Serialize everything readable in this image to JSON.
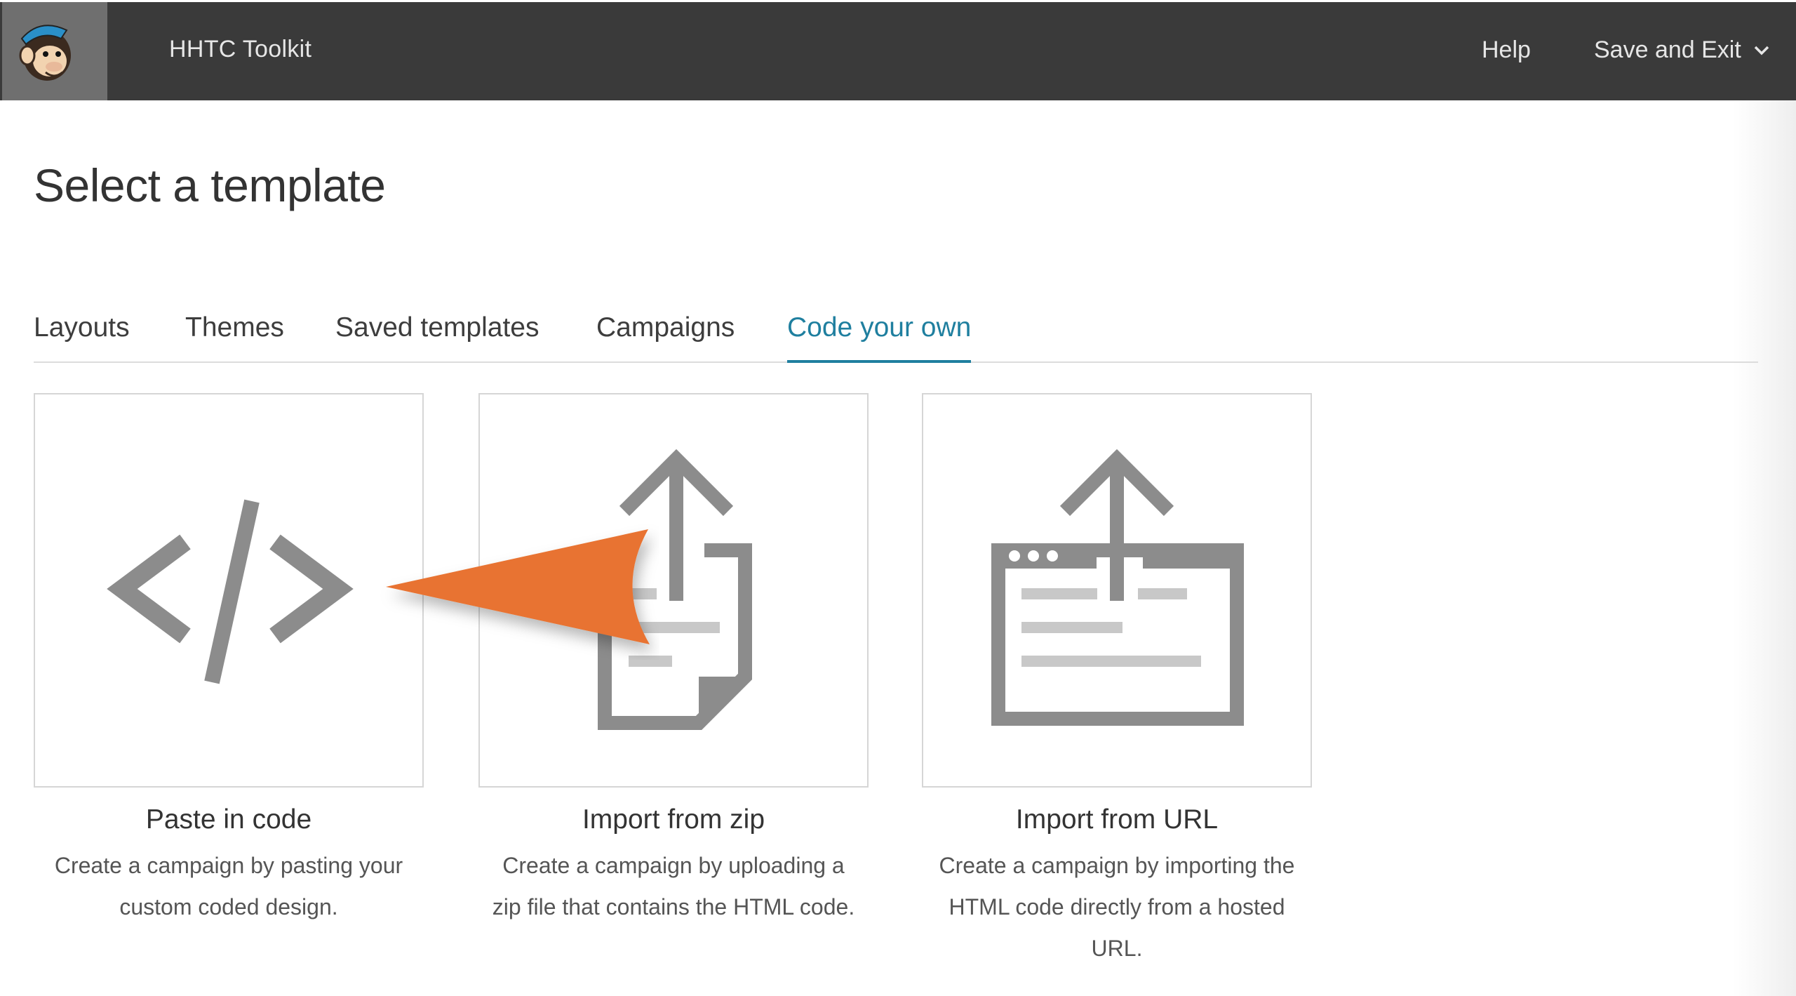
{
  "header": {
    "app_title": "HHTC Toolkit",
    "help_label": "Help",
    "save_exit_label": "Save and Exit",
    "logo_icon": "mailchimp-monkey-logo",
    "bar_color": "#3a3a3a"
  },
  "page": {
    "title": "Select a template"
  },
  "tabs": [
    {
      "label": "Layouts",
      "active": false
    },
    {
      "label": "Themes",
      "active": false
    },
    {
      "label": "Saved templates",
      "active": false
    },
    {
      "label": "Campaigns",
      "active": false
    },
    {
      "label": "Code your own",
      "active": true
    }
  ],
  "accent_color": "#1f7f9f",
  "annotation_color": "#e87330",
  "cards": [
    {
      "icon": "code-icon",
      "title": "Paste in code",
      "description_line1": "Create a campaign by pasting your",
      "description_line2": "custom coded design."
    },
    {
      "icon": "upload-file-icon",
      "title": "Import from zip",
      "description_line1": "Create a campaign by uploading a",
      "description_line2": "zip file that contains the HTML code."
    },
    {
      "icon": "upload-browser-icon",
      "title": "Import from URL",
      "description_line1": "Create a campaign by importing the",
      "description_line2": "HTML code directly from a hosted",
      "description_line3": "URL."
    }
  ]
}
